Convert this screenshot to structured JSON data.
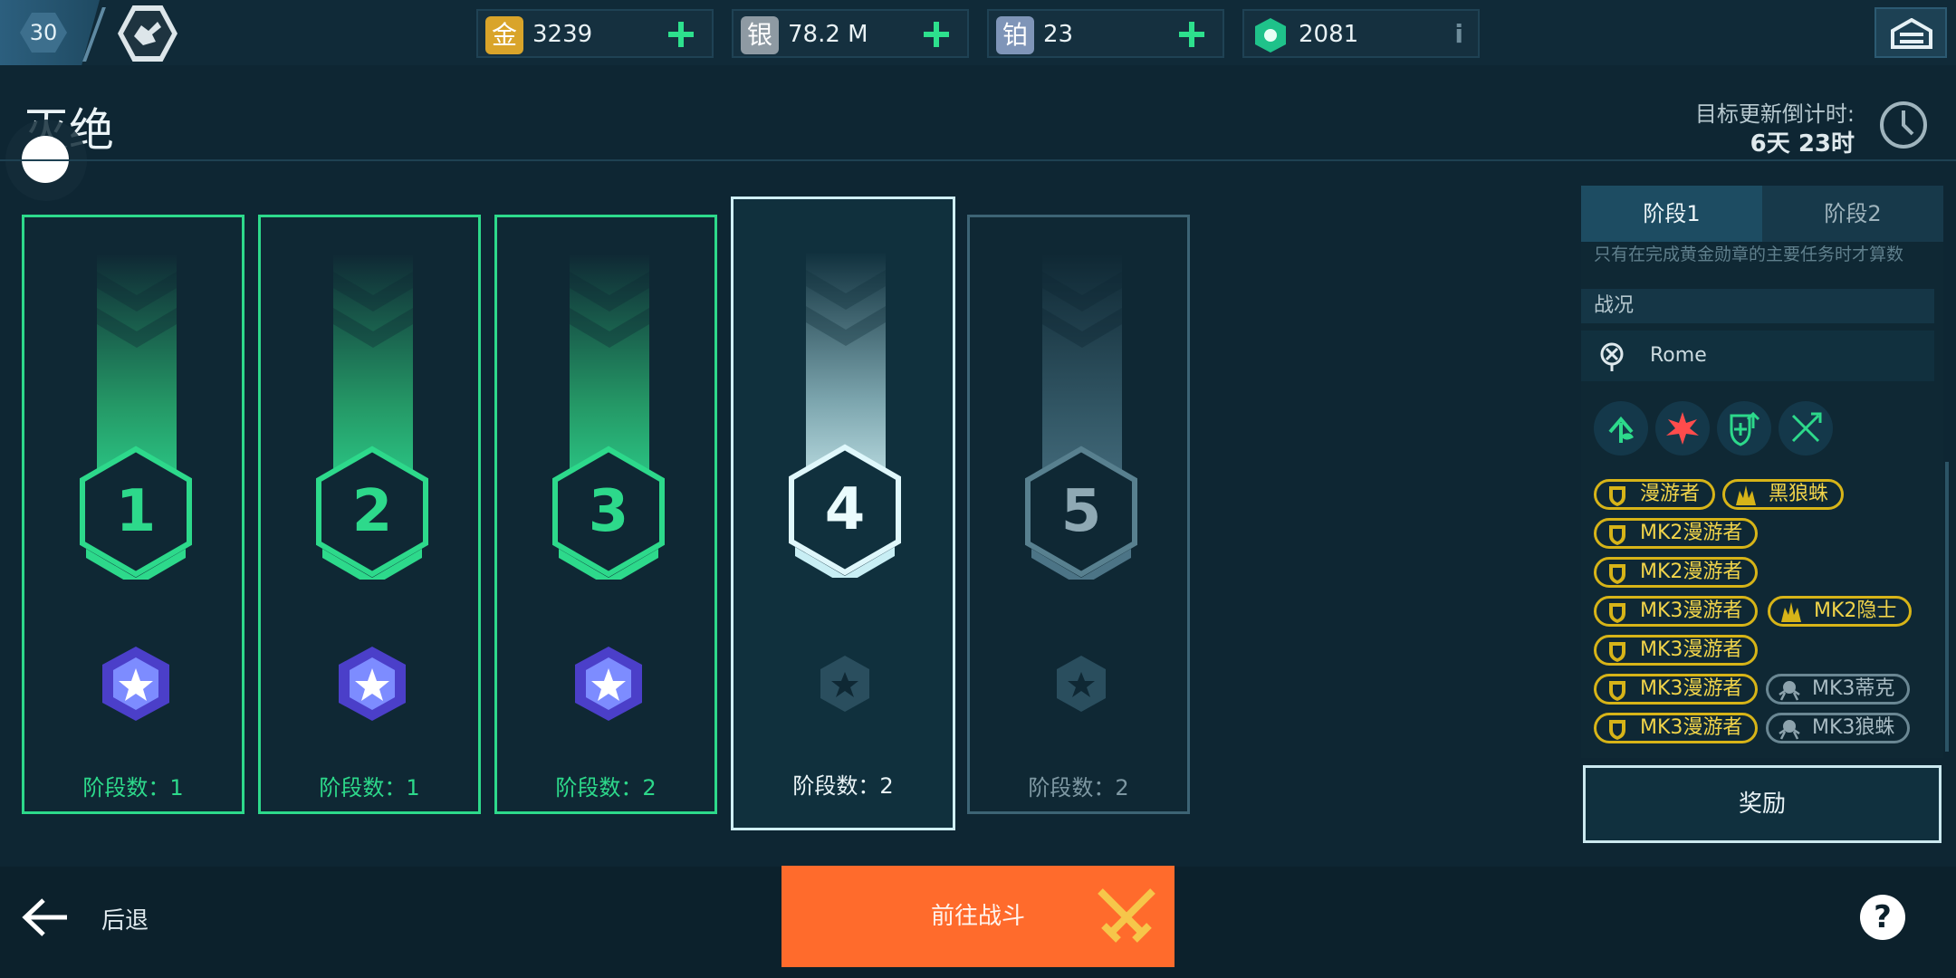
{
  "player": {
    "level": "30"
  },
  "currencies": [
    {
      "name": "gold",
      "glyph": "金",
      "value": "3239",
      "color": "#d9a42a"
    },
    {
      "name": "silver",
      "glyph": "银",
      "value": "78.2 M",
      "color": "#8e9aa3"
    },
    {
      "name": "platinum",
      "glyph": "铂",
      "value": "23",
      "color": "#7f95b8"
    },
    {
      "name": "key",
      "value": "2081",
      "color": "#1fc28a"
    }
  ],
  "header": {
    "title": "灭绝",
    "timer_label": "目标更新倒计时:",
    "timer_value": "6天 23时"
  },
  "stages": [
    {
      "number": "1",
      "label": "阶段数：1",
      "state": "completed"
    },
    {
      "number": "2",
      "label": "阶段数：1",
      "state": "completed"
    },
    {
      "number": "3",
      "label": "阶段数：2",
      "state": "completed"
    },
    {
      "number": "4",
      "label": "阶段数：2",
      "state": "current"
    },
    {
      "number": "5",
      "label": "阶段数：2",
      "state": "locked"
    }
  ],
  "panel": {
    "tabs": [
      "阶段1",
      "阶段2"
    ],
    "faded_text": "只有在完成黄金勋章的主要任务时才算数",
    "section_title": "战况",
    "location": "Rome",
    "modifiers": [
      "growth-icon",
      "burst-icon",
      "shield-plus-icon",
      "cross-swords-icon"
    ],
    "enemies": [
      [
        "漫游者",
        "黑狼蛛"
      ],
      [
        "MK2漫游者"
      ],
      [
        "MK2漫游者"
      ],
      [
        "MK3漫游者",
        "MK2隐士"
      ],
      [
        "MK3漫游者"
      ],
      [
        "MK3漫游者",
        "MK3蒂克"
      ],
      [
        "MK3漫游者",
        "MK3狼蛛"
      ]
    ],
    "reward_label": "奖励"
  },
  "bottom": {
    "back_label": "后退",
    "go_label": "前往战斗"
  },
  "colors": {
    "accent": "#2dd98b",
    "orange": "#ff6b2c",
    "gold_chip": "#d7b418"
  }
}
